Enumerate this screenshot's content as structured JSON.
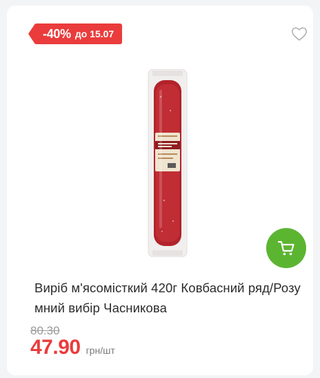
{
  "badge": {
    "discount": "-40%",
    "until": "до 15.07"
  },
  "product": {
    "title": "Виріб м'ясомісткий 420г Ковбасний ряд/Розумний вибір Часникова",
    "image_alt": "sausage-package"
  },
  "price": {
    "old": "80.30",
    "current": "47.90",
    "unit": "грн/шт"
  },
  "icons": {
    "favorite": "heart-icon",
    "cart": "cart-icon"
  },
  "colors": {
    "accent_red": "#ea3c3c",
    "cart_green": "#5cb531"
  }
}
